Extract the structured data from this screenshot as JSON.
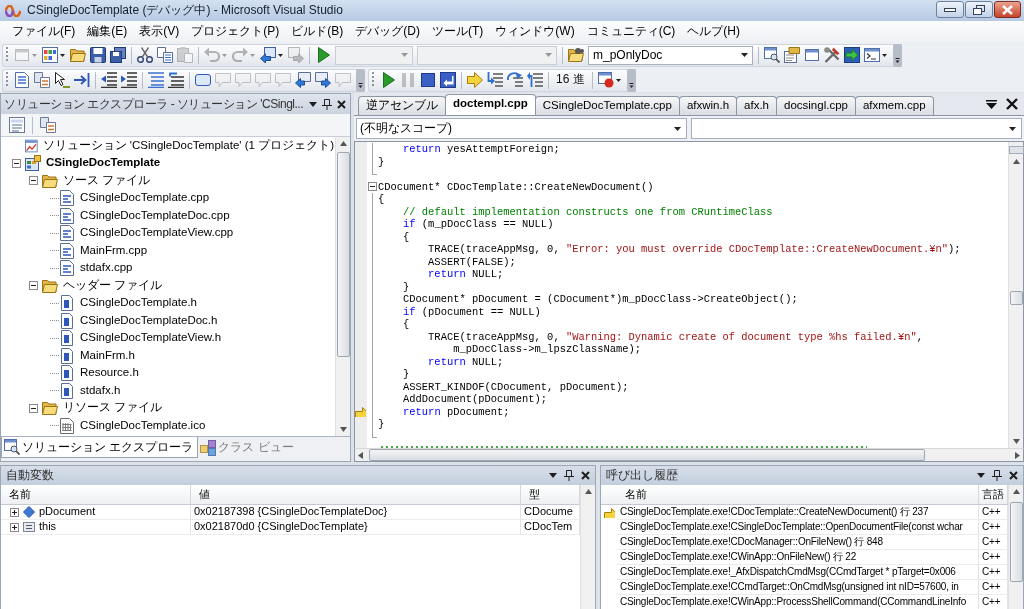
{
  "window": {
    "title": "CSingleDocTemplate (デバッグ中) - Microsoft Visual Studio"
  },
  "menu": [
    "ファイル(F)",
    "編集(E)",
    "表示(V)",
    "プロジェクト(P)",
    "ビルド(B)",
    "デバッグ(D)",
    "ツール(T)",
    "ウィンドウ(W)",
    "コミュニティ(C)",
    "ヘルプ(H)"
  ],
  "toolbar_rows": [
    [
      [
        {
          "kind": "split_button",
          "disabled": true
        },
        {
          "kind": "split_button",
          "disabled": false
        },
        {
          "kind": "button",
          "disabled": false
        },
        {
          "kind": "button",
          "disabled": false
        },
        {
          "kind": "button",
          "disabled": false
        },
        {
          "kind": "separator"
        },
        {
          "kind": "button",
          "disabled": false
        },
        {
          "kind": "button",
          "disabled": false
        },
        {
          "kind": "button",
          "disabled": true
        },
        {
          "kind": "separator"
        },
        {
          "kind": "split_button",
          "disabled": true
        },
        {
          "kind": "split_button",
          "disabled": true
        },
        {
          "kind": "split_button",
          "disabled": false
        },
        {
          "kind": "button",
          "disabled": true
        },
        {
          "kind": "separator"
        },
        {
          "kind": "button",
          "disabled": false
        },
        {
          "kind": "combo",
          "disabled": true
        },
        {
          "kind": "combo",
          "disabled": true
        },
        {
          "kind": "separator"
        },
        {
          "kind": "button",
          "disabled": false
        },
        {
          "kind": "combo",
          "disabled": false,
          "value": "m_pOnlyDoc"
        },
        {
          "kind": "separator"
        },
        {
          "kind": "button",
          "disabled": false
        },
        {
          "kind": "button",
          "disabled": false
        },
        {
          "kind": "button",
          "disabled": false
        },
        {
          "kind": "button",
          "disabled": false
        },
        {
          "kind": "button",
          "disabled": false
        },
        {
          "kind": "split_button",
          "disabled": false
        }
      ]
    ],
    [
      [
        {
          "kind": "button",
          "disabled": false
        },
        {
          "kind": "button",
          "disabled": false
        },
        {
          "kind": "button",
          "disabled": false
        },
        {
          "kind": "button",
          "disabled": false
        },
        {
          "kind": "separator"
        },
        {
          "kind": "button",
          "disabled": false
        },
        {
          "kind": "button",
          "disabled": false
        },
        {
          "kind": "separator"
        },
        {
          "kind": "button",
          "disabled": false
        },
        {
          "kind": "button",
          "disabled": false
        },
        {
          "kind": "separator"
        },
        {
          "kind": "button",
          "disabled": false
        },
        {
          "kind": "button",
          "disabled": true
        },
        {
          "kind": "button",
          "disabled": true
        },
        {
          "kind": "button",
          "disabled": true
        },
        {
          "kind": "button",
          "disabled": true
        },
        {
          "kind": "button",
          "disabled": false
        },
        {
          "kind": "button",
          "disabled": false
        },
        {
          "kind": "button",
          "disabled": true
        }
      ],
      [
        {
          "kind": "button",
          "disabled": false
        },
        {
          "kind": "button",
          "disabled": true
        },
        {
          "kind": "button",
          "disabled": false
        },
        {
          "kind": "button",
          "disabled": false
        },
        {
          "kind": "separator"
        },
        {
          "kind": "button",
          "disabled": false
        },
        {
          "kind": "button",
          "disabled": false
        },
        {
          "kind": "button",
          "disabled": false
        },
        {
          "kind": "button",
          "disabled": false
        },
        {
          "kind": "separator"
        },
        {
          "kind": "text_button",
          "label": "16 進"
        },
        {
          "kind": "separator"
        },
        {
          "kind": "split_button",
          "disabled": false
        }
      ]
    ]
  ],
  "solution_explorer": {
    "title": "ソリューション エクスプローラ - ソリューション 'CSingl...",
    "tree": [
      {
        "kind": "solution",
        "label": "ソリューション 'CSingleDocTemplate' (1 プロジェクト)",
        "children": [
          {
            "kind": "project",
            "label": "CSingleDocTemplate",
            "expanded": true,
            "children": [
              {
                "kind": "folder",
                "label": "ソース ファイル",
                "expanded": true,
                "children": [
                  {
                    "kind": "source",
                    "label": "CSingleDocTemplate.cpp"
                  },
                  {
                    "kind": "source",
                    "label": "CSingleDocTemplateDoc.cpp"
                  },
                  {
                    "kind": "source",
                    "label": "CSingleDocTemplateView.cpp"
                  },
                  {
                    "kind": "source",
                    "label": "MainFrm.cpp"
                  },
                  {
                    "kind": "source",
                    "label": "stdafx.cpp"
                  }
                ]
              },
              {
                "kind": "folder",
                "label": "ヘッダー ファイル",
                "expanded": true,
                "children": [
                  {
                    "kind": "header",
                    "label": "CSingleDocTemplate.h"
                  },
                  {
                    "kind": "header",
                    "label": "CSingleDocTemplateDoc.h"
                  },
                  {
                    "kind": "header",
                    "label": "CSingleDocTemplateView.h"
                  },
                  {
                    "kind": "header",
                    "label": "MainFrm.h"
                  },
                  {
                    "kind": "header",
                    "label": "Resource.h"
                  },
                  {
                    "kind": "header",
                    "label": "stdafx.h"
                  }
                ]
              },
              {
                "kind": "folder",
                "label": "リソース ファイル",
                "expanded": true,
                "children": [
                  {
                    "kind": "resource",
                    "label": "CSingleDocTemplate.ico"
                  }
                ]
              }
            ]
          }
        ]
      }
    ],
    "tabs": [
      {
        "label": "ソリューション エクスプローラ",
        "selected": true
      },
      {
        "label": "クラス ビュー",
        "selected": false
      }
    ]
  },
  "editor": {
    "tabs": [
      {
        "label": "逆アセンブル",
        "selected": false
      },
      {
        "label": "doctempl.cpp",
        "selected": true
      },
      {
        "label": "CSingleDocTemplate.cpp",
        "selected": false
      },
      {
        "label": "afxwin.h",
        "selected": false
      },
      {
        "label": "afx.h",
        "selected": false
      },
      {
        "label": "docsingl.cpp",
        "selected": false
      },
      {
        "label": "afxmem.cpp",
        "selected": false
      }
    ],
    "scope": "(不明なスコープ)",
    "lines": [
      {
        "current": false,
        "tokens": [
          {
            "kind": "keyword",
            "text": "    return"
          },
          {
            "kind": "plain",
            "text": " yesAttemptForeign;"
          }
        ]
      },
      {
        "current": false,
        "tokens": [
          {
            "kind": "plain",
            "text": "}"
          }
        ]
      },
      {
        "current": false
      },
      {
        "current": false,
        "expanded": true,
        "tokens": [
          {
            "kind": "plain",
            "text": "CDocument* CDocTemplate::CreateNewDocument()"
          }
        ]
      },
      {
        "current": false,
        "tokens": [
          {
            "kind": "plain",
            "text": "{"
          }
        ]
      },
      {
        "current": false,
        "tokens": [
          {
            "kind": "comment",
            "text": "    // default implementation constructs one from CRuntimeClass"
          }
        ]
      },
      {
        "current": false,
        "tokens": [
          {
            "kind": "keyword",
            "text": "    if"
          },
          {
            "kind": "plain",
            "text": " (m_pDocClass == NULL)"
          }
        ]
      },
      {
        "current": false,
        "tokens": [
          {
            "kind": "plain",
            "text": "    {"
          }
        ]
      },
      {
        "current": false,
        "tokens": [
          {
            "kind": "plain",
            "text": "        TRACE(traceAppMsg, 0, "
          },
          {
            "kind": "string",
            "text": "\"Error: you must override CDocTemplate::CreateNewDocument.¥n\""
          },
          {
            "kind": "plain",
            "text": ");"
          }
        ]
      },
      {
        "current": false,
        "tokens": [
          {
            "kind": "plain",
            "text": "        ASSERT(FALSE);"
          }
        ]
      },
      {
        "current": false,
        "tokens": [
          {
            "kind": "keyword",
            "text": "        return"
          },
          {
            "kind": "plain",
            "text": " NULL;"
          }
        ]
      },
      {
        "current": false,
        "tokens": [
          {
            "kind": "plain",
            "text": "    }"
          }
        ]
      },
      {
        "current": false,
        "tokens": [
          {
            "kind": "plain",
            "text": "    CDocument* pDocument = (CDocument*)m_pDocClass->CreateObject();"
          }
        ]
      },
      {
        "current": false,
        "tokens": [
          {
            "kind": "keyword",
            "text": "    if"
          },
          {
            "kind": "plain",
            "text": " (pDocument == NULL)"
          }
        ]
      },
      {
        "current": false,
        "tokens": [
          {
            "kind": "plain",
            "text": "    {"
          }
        ]
      },
      {
        "current": false,
        "tokens": [
          {
            "kind": "plain",
            "text": "        TRACE(traceAppMsg, 0, "
          },
          {
            "kind": "string",
            "text": "\"Warning: Dynamic create of document type %hs failed.¥n\""
          },
          {
            "kind": "plain",
            "text": ","
          }
        ]
      },
      {
        "current": false,
        "tokens": [
          {
            "kind": "plain",
            "text": "            m_pDocClass->m_lpszClassName);"
          }
        ]
      },
      {
        "current": false,
        "tokens": [
          {
            "kind": "keyword",
            "text": "        return"
          },
          {
            "kind": "plain",
            "text": " NULL;"
          }
        ]
      },
      {
        "current": false,
        "tokens": [
          {
            "kind": "plain",
            "text": "    }"
          }
        ]
      },
      {
        "current": false,
        "tokens": [
          {
            "kind": "plain",
            "text": "    ASSERT_KINDOF(CDocument, pDocument);"
          }
        ]
      },
      {
        "current": false,
        "tokens": [
          {
            "kind": "plain",
            "text": "    AddDocument(pDocument);"
          }
        ]
      },
      {
        "current": true,
        "tokens": [
          {
            "kind": "keyword",
            "text": "    return"
          },
          {
            "kind": "plain",
            "text": " pDocument;"
          }
        ]
      },
      {
        "current": false,
        "tokens": [
          {
            "kind": "plain",
            "text": "}"
          }
        ]
      }
    ]
  },
  "autos": {
    "title": "自動変数",
    "columns": [
      "名前",
      "値",
      "型"
    ],
    "rows": [
      {
        "kind": "pointer",
        "expanded": false,
        "name": "pDocument",
        "value": "0x02187398 {CSingleDocTemplateDoc}",
        "type": "CDocume"
      },
      {
        "kind": "object",
        "expanded": false,
        "name": "this",
        "value": "0x021870d0 {CSingleDocTemplate}",
        "type": "CDocTem"
      }
    ]
  },
  "call_stack": {
    "title": "呼び出し履歴",
    "columns": [
      "名前",
      "言語"
    ],
    "rows": [
      {
        "current": true,
        "name": "CSingleDocTemplate.exe!CDocTemplate::CreateNewDocument() 行 237",
        "language": "C++"
      },
      {
        "current": false,
        "name": "CSingleDocTemplate.exe!CSingleDocTemplate::OpenDocumentFile(const wchar",
        "language": "C++"
      },
      {
        "current": false,
        "name": "CSingleDocTemplate.exe!CDocManager::OnFileNew() 行 848",
        "language": "C++"
      },
      {
        "current": false,
        "name": "CSingleDocTemplate.exe!CWinApp::OnFileNew() 行 22",
        "language": "C++"
      },
      {
        "current": false,
        "name": "CSingleDocTemplate.exe!_AfxDispatchCmdMsg(CCmdTarget * pTarget=0x006",
        "language": "C++"
      },
      {
        "current": false,
        "name": "CSingleDocTemplate.exe!CCmdTarget::OnCmdMsg(unsigned int nID=57600, in",
        "language": "C++"
      },
      {
        "current": false,
        "name": "CSingleDocTemplate.exe!CWinApp::ProcessShellCommand(CCommandLineInfo",
        "language": "C++"
      }
    ]
  }
}
